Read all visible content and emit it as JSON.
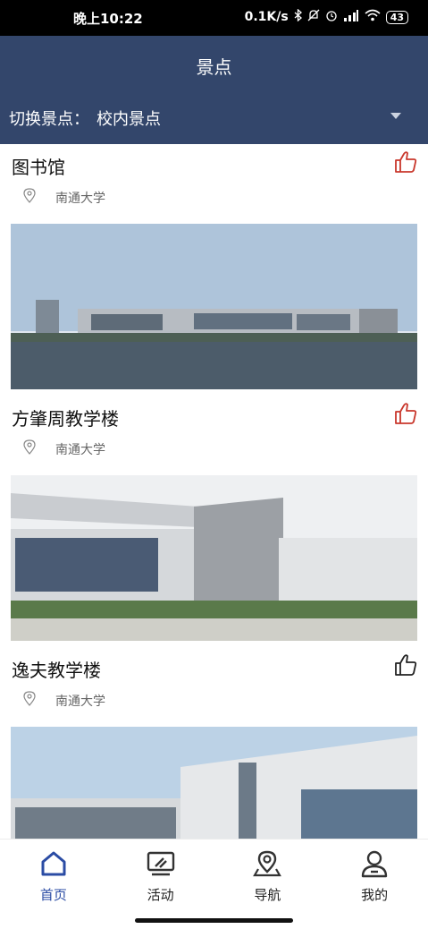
{
  "status_bar": {
    "time": "晚上10:22",
    "network_speed": "0.1K/s",
    "battery": "43"
  },
  "header": {
    "title": "景点",
    "switch_label": "切换景点：",
    "switch_value": "校内景点"
  },
  "spots": [
    {
      "name": "图书馆",
      "location": "南通大学",
      "liked": true
    },
    {
      "name": "方肇周教学楼",
      "location": "南通大学",
      "liked": true
    },
    {
      "name": "逸夫教学楼",
      "location": "南通大学",
      "liked": false
    }
  ],
  "tabs": [
    {
      "label": "首页",
      "icon": "home-icon",
      "active": true
    },
    {
      "label": "活动",
      "icon": "monitor-icon",
      "active": false
    },
    {
      "label": "导航",
      "icon": "map-pin-icon",
      "active": false
    },
    {
      "label": "我的",
      "icon": "user-icon",
      "active": false
    }
  ],
  "colors": {
    "header_bg": "#33466b",
    "like_active": "#c9372c",
    "tab_active": "#2b4ca4"
  }
}
